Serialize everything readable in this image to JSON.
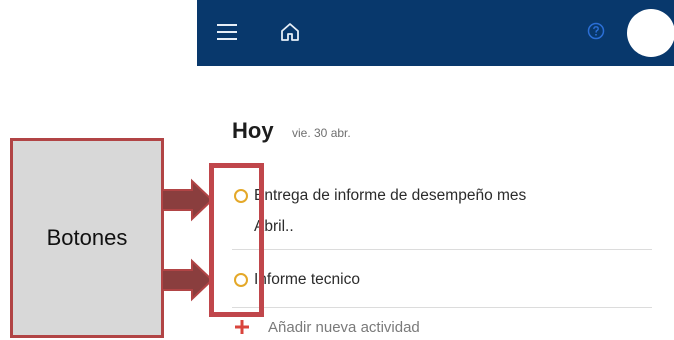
{
  "header": {
    "menu_icon": "hamburger-menu-icon",
    "home_icon": "home-icon",
    "help_icon": "help-circle-icon",
    "bar_color": "#08386c"
  },
  "day": {
    "title": "Hoy",
    "date": "vie. 30 abr."
  },
  "tasks": [
    {
      "line1": "Entrega de informe de desempeño mes",
      "line2": "Abril..",
      "status": "pending"
    },
    {
      "line1": "Informe tecnico",
      "status": "pending"
    }
  ],
  "add_activity": {
    "label": "Añadir nueva actividad",
    "icon": "plus-icon",
    "accent_color": "#d9443c"
  },
  "annotation": {
    "label": "Botones",
    "border_color": "#c0464b"
  }
}
